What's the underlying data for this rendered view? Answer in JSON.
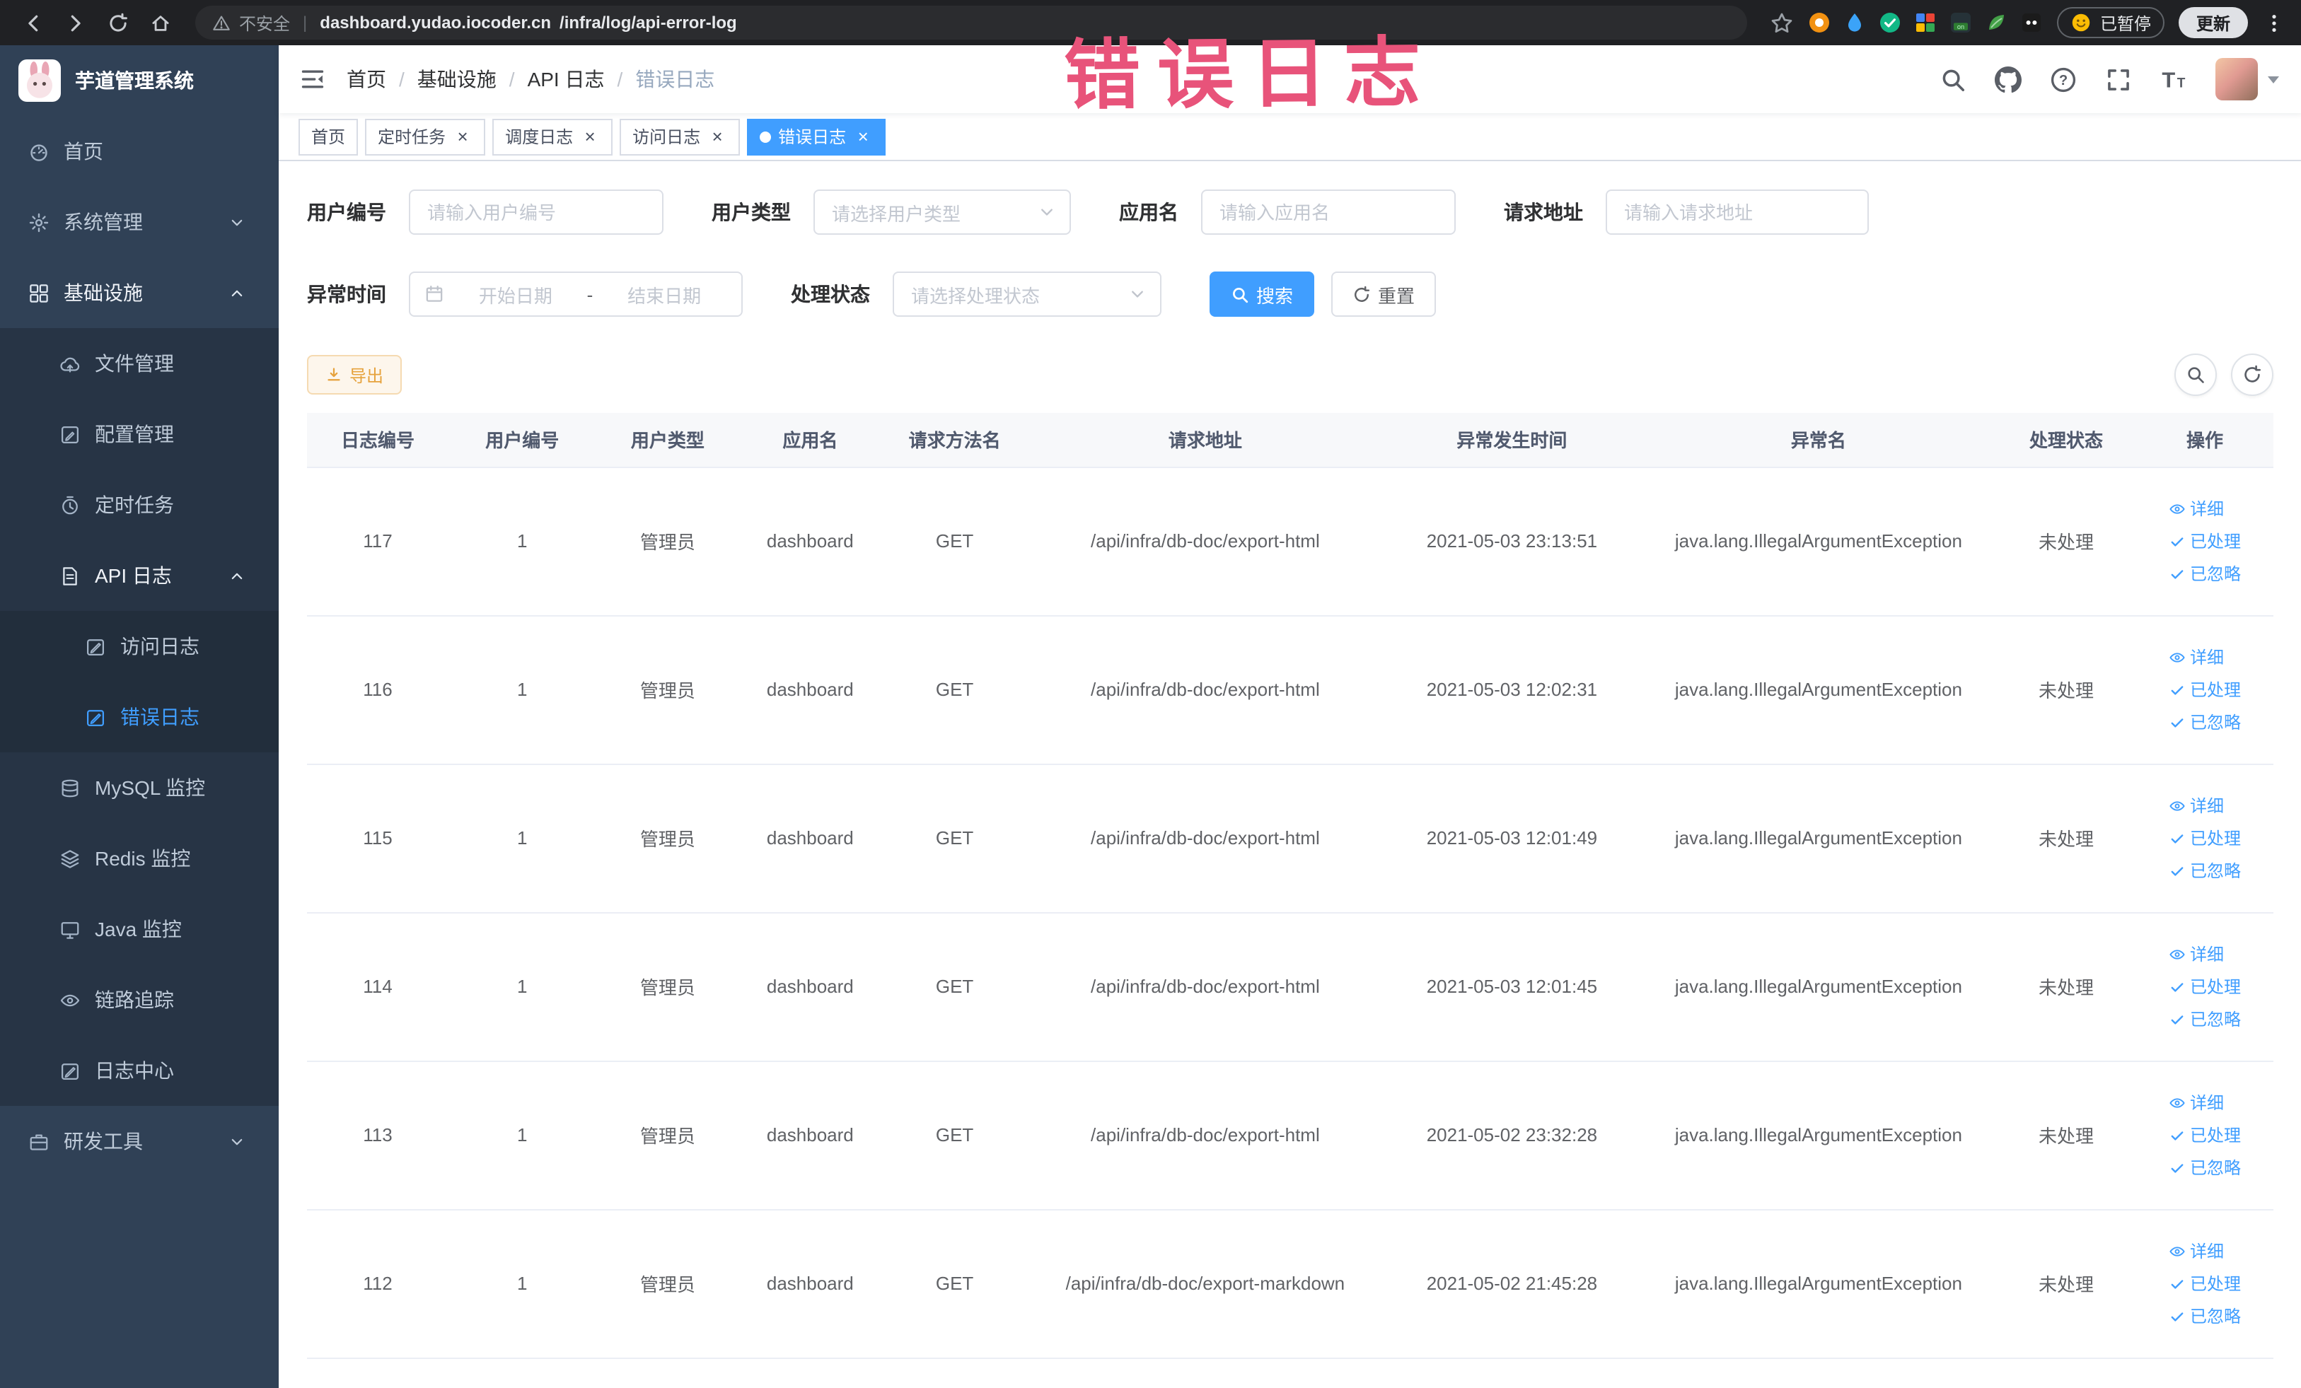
{
  "browser": {
    "not_secure": "不安全",
    "url_domain": "dashboard.yudao.iocoder.cn",
    "url_path": "/infra/log/api-error-log",
    "paused_label": "已暂停",
    "update_label": "更新",
    "nav_icons": [
      "back-icon",
      "forward-icon",
      "reload-icon",
      "home-icon"
    ],
    "extension_icons": [
      "orange-extension-icon",
      "drop-extension-icon",
      "green-check-extension-icon",
      "grid-extension-icon",
      "on-badge-extension-icon",
      "leaf-extension-icon",
      "dark-extension-icon"
    ]
  },
  "annotation": {
    "text": "错误日志",
    "color": "#e8537a"
  },
  "sidebar": {
    "logo_title": "芋道管理系统",
    "menu": [
      {
        "label": "首页",
        "icon": "dashboard-icon",
        "depth": 0
      },
      {
        "label": "系统管理",
        "icon": "gear-icon",
        "depth": 0,
        "arrow": "down"
      },
      {
        "label": "基础设施",
        "icon": "infra-icon",
        "depth": 0,
        "arrow": "up",
        "bright": true
      },
      {
        "label": "文件管理",
        "icon": "file-icon",
        "depth": 1
      },
      {
        "label": "配置管理",
        "icon": "config-icon",
        "depth": 1
      },
      {
        "label": "定时任务",
        "icon": "timer-icon",
        "depth": 1
      },
      {
        "label": "API 日志",
        "icon": "api-log-icon",
        "depth": 1,
        "arrow": "up",
        "bright": true
      },
      {
        "label": "访问日志",
        "icon": "access-log-icon",
        "depth": 2
      },
      {
        "label": "错误日志",
        "icon": "error-log-icon",
        "depth": 2,
        "active": true
      },
      {
        "label": "MySQL 监控",
        "icon": "mysql-icon",
        "depth": 1
      },
      {
        "label": "Redis 监控",
        "icon": "redis-icon",
        "depth": 1
      },
      {
        "label": "Java 监控",
        "icon": "java-icon",
        "depth": 1
      },
      {
        "label": "链路追踪",
        "icon": "trace-icon",
        "depth": 1
      },
      {
        "label": "日志中心",
        "icon": "log-center-icon",
        "depth": 1
      },
      {
        "label": "研发工具",
        "icon": "tool-icon",
        "depth": 0,
        "arrow": "down"
      }
    ]
  },
  "header": {
    "breadcrumb": [
      "首页",
      "基础设施",
      "API 日志",
      "错误日志"
    ],
    "action_icons": [
      "search-icon",
      "github-icon",
      "question-icon",
      "fullscreen-icon",
      "font-size-icon"
    ]
  },
  "tabs": [
    {
      "label": "首页",
      "closable": false,
      "active": false
    },
    {
      "label": "定时任务",
      "closable": true,
      "active": false
    },
    {
      "label": "调度日志",
      "closable": true,
      "active": false
    },
    {
      "label": "访问日志",
      "closable": true,
      "active": false
    },
    {
      "label": "错误日志",
      "closable": true,
      "active": true
    }
  ],
  "filters": {
    "user_id": {
      "label": "用户编号",
      "placeholder": "请输入用户编号"
    },
    "user_type": {
      "label": "用户类型",
      "placeholder": "请选择用户类型"
    },
    "app_name": {
      "label": "应用名",
      "placeholder": "请输入应用名"
    },
    "request_url": {
      "label": "请求地址",
      "placeholder": "请输入请求地址"
    },
    "exception_time": {
      "label": "异常时间",
      "start_placeholder": "开始日期",
      "separator": "-",
      "end_placeholder": "结束日期"
    },
    "process_status": {
      "label": "处理状态",
      "placeholder": "请选择处理状态"
    },
    "search_label": "搜索",
    "reset_label": "重置"
  },
  "toolbar": {
    "export_label": "导出"
  },
  "table": {
    "columns": [
      "日志编号",
      "用户编号",
      "用户类型",
      "应用名",
      "请求方法名",
      "请求地址",
      "异常发生时间",
      "异常名",
      "处理状态",
      "操作"
    ],
    "action_labels": [
      "详细",
      "已处理",
      "已忽略"
    ],
    "rows": [
      {
        "id": "117",
        "user_id": "1",
        "user_type": "管理员",
        "app": "dashboard",
        "method": "GET",
        "url": "/api/infra/db-doc/export-html",
        "time": "2021-05-03 23:13:51",
        "exception": "java.lang.IllegalArgumentException",
        "status": "未处理"
      },
      {
        "id": "116",
        "user_id": "1",
        "user_type": "管理员",
        "app": "dashboard",
        "method": "GET",
        "url": "/api/infra/db-doc/export-html",
        "time": "2021-05-03 12:02:31",
        "exception": "java.lang.IllegalArgumentException",
        "status": "未处理"
      },
      {
        "id": "115",
        "user_id": "1",
        "user_type": "管理员",
        "app": "dashboard",
        "method": "GET",
        "url": "/api/infra/db-doc/export-html",
        "time": "2021-05-03 12:01:49",
        "exception": "java.lang.IllegalArgumentException",
        "status": "未处理"
      },
      {
        "id": "114",
        "user_id": "1",
        "user_type": "管理员",
        "app": "dashboard",
        "method": "GET",
        "url": "/api/infra/db-doc/export-html",
        "time": "2021-05-03 12:01:45",
        "exception": "java.lang.IllegalArgumentException",
        "status": "未处理"
      },
      {
        "id": "113",
        "user_id": "1",
        "user_type": "管理员",
        "app": "dashboard",
        "method": "GET",
        "url": "/api/infra/db-doc/export-html",
        "time": "2021-05-02 23:32:28",
        "exception": "java.lang.IllegalArgumentException",
        "status": "未处理"
      },
      {
        "id": "112",
        "user_id": "1",
        "user_type": "管理员",
        "app": "dashboard",
        "method": "GET",
        "url": "/api/infra/db-doc/export-markdown",
        "time": "2021-05-02 21:45:28",
        "exception": "java.lang.IllegalArgumentException",
        "status": "未处理"
      }
    ]
  },
  "colors": {
    "accent": "#409eff",
    "warning": "#e6a23c",
    "sidebar_bg": "#304156",
    "submenu_bg": "#273445",
    "annotation": "#e8537a",
    "chrome_bg": "#202124"
  }
}
